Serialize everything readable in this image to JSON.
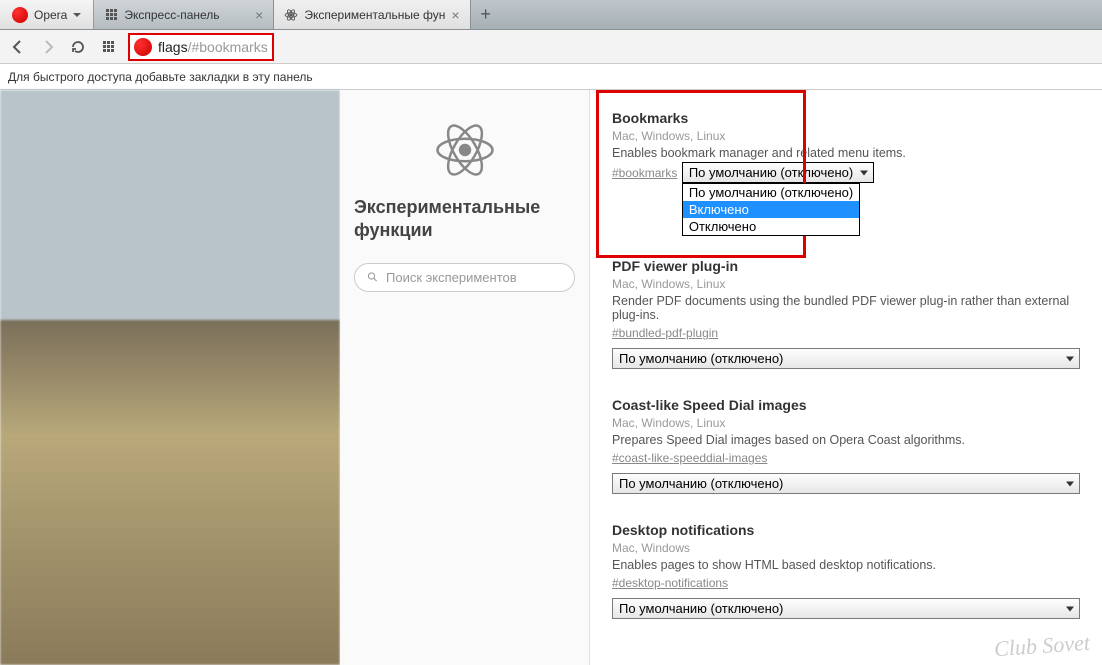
{
  "titlebar": {
    "app_name": "Opera",
    "tabs": [
      {
        "label": "Экспресс-панель",
        "active": false
      },
      {
        "label": "Экспериментальные фун",
        "active": true
      }
    ]
  },
  "toolbar": {
    "address_main": "flags",
    "address_fragment": "/#bookmarks"
  },
  "hint": "Для быстрого доступа добавьте закладки в эту панель",
  "page": {
    "title": "Экспериментальные функции",
    "search_placeholder": "Поиск экспериментов"
  },
  "dropdown_options": {
    "current": "По умолчанию (отключено)",
    "list": [
      "По умолчанию (отключено)",
      "Включено",
      "Отключено"
    ],
    "highlighted_index": 1
  },
  "flags": [
    {
      "title": "Bookmarks",
      "platforms": "Mac, Windows, Linux",
      "desc": "Enables bookmark manager and related menu items.",
      "anchor": "#bookmarks",
      "value": "По умолчанию (отключено)",
      "open": true
    },
    {
      "title": "PDF viewer plug-in",
      "platforms": "Mac, Windows, Linux",
      "desc": "Render PDF documents using the bundled PDF viewer plug-in rather than external plug-ins.",
      "anchor": "#bundled-pdf-plugin",
      "value": "По умолчанию (отключено)",
      "open": false
    },
    {
      "title": "Coast-like Speed Dial images",
      "platforms": "Mac, Windows, Linux",
      "desc": "Prepares Speed Dial images based on Opera Coast algorithms.",
      "anchor": "#coast-like-speeddial-images",
      "value": "По умолчанию (отключено)",
      "open": false
    },
    {
      "title": "Desktop notifications",
      "platforms": "Mac, Windows",
      "desc": "Enables pages to show HTML based desktop notifications.",
      "anchor": "#desktop-notifications",
      "value": "По умолчанию (отключено)",
      "open": false
    }
  ],
  "watermark": "Club Sovet"
}
